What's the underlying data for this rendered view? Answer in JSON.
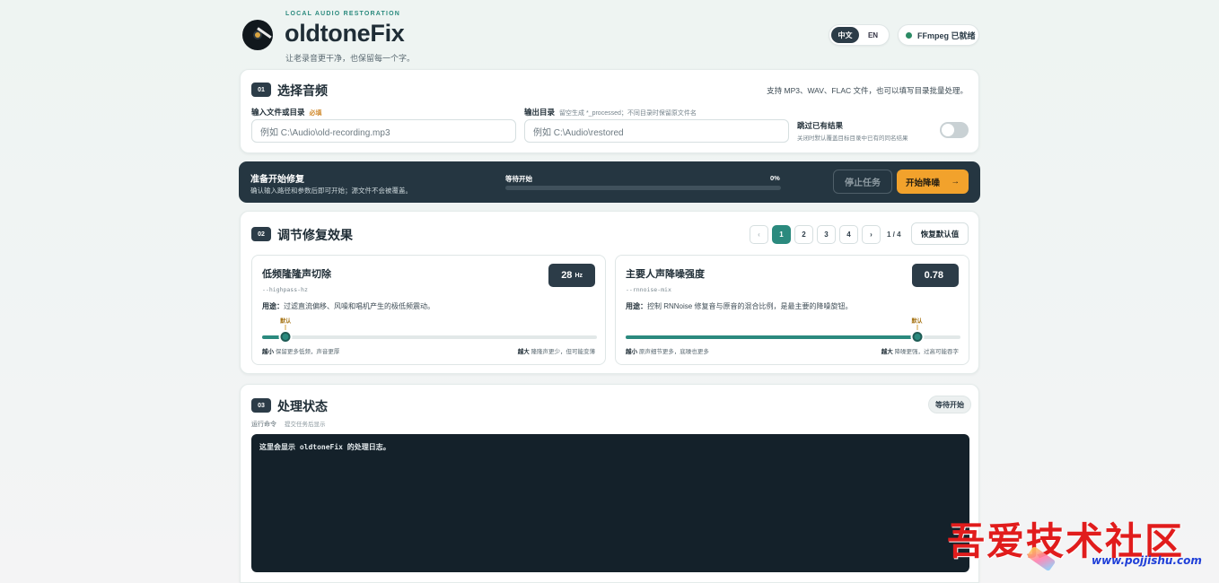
{
  "header": {
    "eyebrow": "LOCAL AUDIO RESTORATION",
    "brand": "oldtoneFix",
    "tagline": "让老录音更干净，也保留每一个字。",
    "lang": {
      "zh": "中文",
      "en": "EN",
      "active": "zh"
    },
    "ffmpeg_status": "FFmpeg 已就绪"
  },
  "section1": {
    "num": "01",
    "title": "选择音频",
    "hint": "支持 MP3、WAV、FLAC 文件，也可以填写目录批量处理。",
    "input": {
      "label": "输入文件或目录",
      "required": "必填",
      "placeholder": "例如 C:\\Audio\\old-recording.mp3",
      "value": ""
    },
    "output": {
      "label": "输出目录",
      "note": "留空生成 *_processed；不同目录时保留原文件名",
      "placeholder": "例如 C:\\Audio\\restored",
      "value": ""
    },
    "skip": {
      "title": "跳过已有结果",
      "desc": "关闭时默认覆盖目标目录中已有的同名结果",
      "enabled": false
    }
  },
  "statusbar": {
    "title": "准备开始修复",
    "desc": "确认输入路径和参数后即可开始；源文件不会被覆盖。",
    "progress_label": "等待开始",
    "progress_value": "0%",
    "progress": 0,
    "stop_label": "停止任务",
    "start_label": "开始降噪",
    "start_arrow": "→"
  },
  "section2": {
    "num": "02",
    "title": "调节修复效果",
    "pager": {
      "prev": "‹",
      "next": "›",
      "pages": [
        "1",
        "2",
        "3",
        "4"
      ],
      "active": "1",
      "count": "1 / 4"
    },
    "reset_label": "恢复默认值",
    "params": [
      {
        "name": "低频隆隆声切除",
        "flag": "--highpass-hz",
        "value": "28",
        "unit": "Hz",
        "use_label": "用途：",
        "use_text": "过滤直流偏移、风噪和唱机产生的极低频震动。",
        "default_tag": "默认",
        "slider_fraction": 0.07,
        "default_fraction": 0.07,
        "min_label": "越小",
        "min_text": "保留更多低频，声音更厚",
        "max_label": "越大",
        "max_text": "隆隆声更少，但可能变薄"
      },
      {
        "name": "主要人声降噪强度",
        "flag": "--rnnoise-mix",
        "value": "0.78",
        "unit": "",
        "use_label": "用途：",
        "use_text": "控制 RNNoise 修复音与原音的混合比例，是最主要的降噪旋钮。",
        "default_tag": "默认",
        "slider_fraction": 0.87,
        "default_fraction": 0.87,
        "min_label": "越小",
        "min_text": "原声细节更多，底噪也更多",
        "max_label": "越大",
        "max_text": "降噪更强，过高可能吞字"
      }
    ]
  },
  "section3": {
    "num": "03",
    "title": "处理状态",
    "badge": "等待开始",
    "cmd_label": "运行命令",
    "cmd_value": "提交任务后显示",
    "log_text": "这里会显示 oldtoneFix 的处理日志。"
  },
  "watermark": {
    "title": "吾爱技术社区",
    "url": "www.pojjishu.com"
  }
}
